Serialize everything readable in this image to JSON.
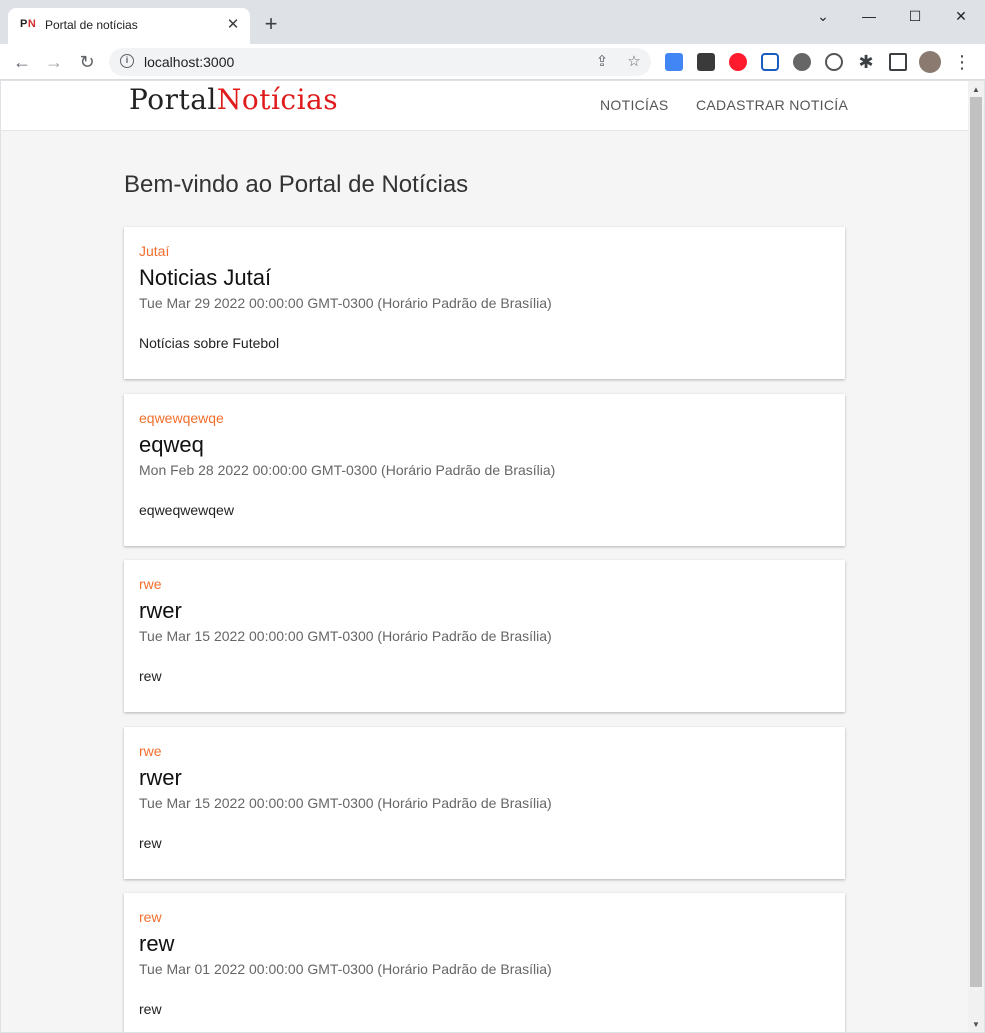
{
  "browser": {
    "tab_favicon_p": "P",
    "tab_favicon_n": "N",
    "tab_title": "Portal de notícias",
    "url": "localhost:3000",
    "window_controls": [
      "chevron-down-icon",
      "minimize-icon",
      "maximize-icon",
      "close-icon"
    ],
    "extensions": [
      "google-translate-icon",
      "extension-dark-icon",
      "opera-icon",
      "malwarebytes-icon",
      "extension-circles-icon",
      "extension-bug-icon",
      "puzzle-icon",
      "sidebar-icon"
    ]
  },
  "navbar": {
    "logo_part1": "Portal",
    "logo_part2": "Notícias",
    "links": [
      "NOTICÍAS",
      "CADASTRAR NOTICÍA"
    ]
  },
  "main": {
    "title": "Bem-vindo ao Portal de Notícias",
    "news": [
      {
        "category": "Jutaí",
        "title": "Noticias Jutaí",
        "date": "Tue Mar 29 2022 00:00:00 GMT-0300 (Horário Padrão de Brasília)",
        "body": "Notícias sobre Futebol"
      },
      {
        "category": "eqwewqewqe",
        "title": "eqweq",
        "date": "Mon Feb 28 2022 00:00:00 GMT-0300 (Horário Padrão de Brasília)",
        "body": "eqweqwewqew"
      },
      {
        "category": "rwe",
        "title": "rwer",
        "date": "Tue Mar 15 2022 00:00:00 GMT-0300 (Horário Padrão de Brasília)",
        "body": "rew"
      },
      {
        "category": "rwe",
        "title": "rwer",
        "date": "Tue Mar 15 2022 00:00:00 GMT-0300 (Horário Padrão de Brasília)",
        "body": "rew"
      },
      {
        "category": "rew",
        "title": "rew",
        "date": "Tue Mar 01 2022 00:00:00 GMT-0300 (Horário Padrão de Brasília)",
        "body": "rew"
      }
    ]
  },
  "colors": {
    "accent_red": "#e01b1b",
    "category_orange": "#f26f2c",
    "page_background": "#f5f5f5"
  }
}
